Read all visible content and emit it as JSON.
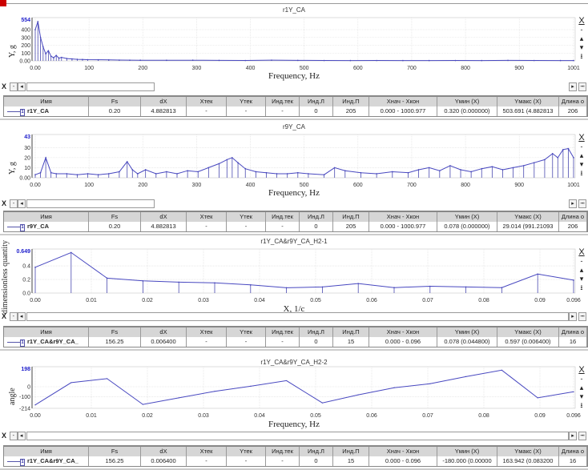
{
  "table_headers": [
    "Имя",
    "Fs",
    "dX",
    "Xтек",
    "Yтек",
    "Инд.тек",
    "Инд.Л",
    "Инд.П",
    "Xнач - Xкон",
    "Yмин (X)",
    "Yмакс (X)",
    "Длина о"
  ],
  "toolbar": {
    "close": "X",
    "zoom_out": "-",
    "pan_up": "▴",
    "pan_down": "▾",
    "fit": "⭳",
    "scroll_x": "X",
    "scroll_minus": "-",
    "left": "◂",
    "right": "▸",
    "end": "⭲"
  },
  "panels": [
    {
      "title": "r1Y_CA",
      "ylabel": "Y, g",
      "xlabel": "Frequency, Hz",
      "ymax_label": "554",
      "row": [
        "r1Y_CA",
        "0.20",
        "4.882813",
        "-",
        "-",
        "-",
        "0",
        "205",
        "0.000 - 1000.977",
        "0.320 (0.000000)",
        "503.691 (4.882813",
        "206"
      ]
    },
    {
      "title": "r9Y_CA",
      "ylabel": "Y, g",
      "xlabel": "Frequency, Hz",
      "ymax_label": "43",
      "row": [
        "r9Y_CA",
        "0.20",
        "4.882813",
        "-",
        "-",
        "-",
        "0",
        "205",
        "0.000 - 1000.977",
        "0.078 (0.000000)",
        "29.014 (991.21093",
        "206"
      ]
    },
    {
      "title": "r1Y_CA&r9Y_CA_H2-1",
      "ylabel": "dimensionless quantity",
      "xlabel": "X, 1/c",
      "ymax_label": "0.649",
      "row": [
        "r1Y_CA&r9Y_CA_",
        "156.25",
        "0.006400",
        "-",
        "-",
        "-",
        "0",
        "15",
        "0.000 - 0.096",
        "0.078 (0.044800)",
        "0.597 (0.006400)",
        "16"
      ]
    },
    {
      "title": "r1Y_CA&r9Y_CA_H2-2",
      "ylabel": "angle",
      "xlabel": "Frequency, Hz",
      "ymax_label": "198",
      "row": [
        "r1Y_CA&r9Y_CA_",
        "156.25",
        "0.006400",
        "-",
        "-",
        "-",
        "0",
        "15",
        "0.000 - 0.096",
        "-180.000 (0.00000",
        "163.942 (0.083200",
        "16"
      ]
    }
  ],
  "chart_data": [
    {
      "type": "line",
      "title": "r1Y_CA",
      "xlabel": "Frequency, Hz",
      "ylabel": "Y, g",
      "xlim": [
        0,
        1001
      ],
      "ylim": [
        0,
        554
      ],
      "xticks": [
        "0.00",
        "100",
        "200",
        "300",
        "400",
        "500",
        "600",
        "700",
        "800",
        "900",
        "1001"
      ],
      "xtick_values": [
        0,
        100,
        200,
        300,
        400,
        500,
        600,
        700,
        800,
        900,
        1001
      ],
      "yticks": [
        "0.00",
        "100",
        "200",
        "300",
        "400"
      ],
      "ytick_values": [
        0,
        100,
        200,
        300,
        400
      ],
      "x": [
        0,
        4.88,
        9.77,
        14.65,
        19.53,
        24.41,
        29.3,
        34.18,
        39.06,
        43.95,
        48.83,
        58.59,
        68.36,
        78.13,
        87.89,
        97.66,
        117.19,
        136.72,
        156.25,
        175.78,
        195.31,
        244.14,
        292.97,
        341.8,
        390.63,
        439.45,
        488.28,
        537.11,
        585.94,
        634.77,
        683.59,
        732.42,
        781.25,
        830.08,
        878.91,
        927.73,
        976.56,
        1000.98
      ],
      "values": [
        400,
        504,
        300,
        180,
        90,
        130,
        60,
        40,
        70,
        35,
        45,
        30,
        25,
        20,
        18,
        15,
        14,
        12,
        10,
        9,
        8,
        7,
        8,
        6,
        5,
        9,
        6,
        5,
        4,
        5,
        4,
        4,
        5,
        4,
        6,
        5,
        4,
        4
      ]
    },
    {
      "type": "line",
      "title": "r9Y_CA",
      "xlabel": "Frequency, Hz",
      "ylabel": "Y, g",
      "xlim": [
        0,
        1001
      ],
      "ylim": [
        0,
        43
      ],
      "xticks": [
        "0.00",
        "100",
        "200",
        "300",
        "400",
        "500",
        "600",
        "700",
        "800",
        "900",
        "1001"
      ],
      "xtick_values": [
        0,
        100,
        200,
        300,
        400,
        500,
        600,
        700,
        800,
        900,
        1001
      ],
      "yticks": [
        "0.00",
        "10",
        "20",
        "30"
      ],
      "ytick_values": [
        0,
        10,
        20,
        30
      ],
      "x": [
        0,
        9.77,
        19.53,
        29.3,
        39.06,
        58.59,
        78.13,
        97.66,
        117.19,
        136.72,
        156.25,
        170.9,
        180.66,
        190.43,
        205.08,
        224.61,
        244.14,
        263.67,
        283.2,
        302.73,
        322.27,
        341.8,
        356.45,
        366.21,
        376.95,
        390.63,
        410.16,
        429.69,
        449.22,
        468.75,
        488.28,
        507.81,
        537.11,
        556.64,
        576.17,
        605.47,
        634.77,
        664.06,
        693.36,
        712.89,
        732.42,
        751.95,
        771.48,
        791.02,
        810.55,
        830.08,
        849.61,
        869.14,
        888.67,
        908.2,
        927.73,
        947.27,
        961.91,
        971.68,
        981.45,
        991.21,
        1000.98
      ],
      "values": [
        3,
        5,
        20,
        5,
        4,
        4,
        3,
        4,
        3,
        4,
        6,
        16,
        8,
        4,
        8,
        4,
        6,
        4,
        7,
        6,
        10,
        14,
        18,
        20,
        15,
        9,
        6,
        5,
        4,
        4,
        5,
        4,
        3,
        10,
        7,
        5,
        4,
        6,
        5,
        8,
        10,
        7,
        12,
        8,
        6,
        9,
        11,
        8,
        10,
        12,
        15,
        18,
        24,
        20,
        28,
        29,
        20
      ]
    },
    {
      "type": "line",
      "title": "r1Y_CA&r9Y_CA_H2-1",
      "xlabel": "X, 1/c",
      "ylabel": "dimensionless quantity",
      "xlim": [
        0,
        0.096
      ],
      "ylim": [
        0,
        0.649
      ],
      "xticks": [
        "0.00",
        "0.01",
        "0.02",
        "0.03",
        "0.04",
        "0.05",
        "0.06",
        "0.07",
        "0.08",
        "0.09",
        "0.096"
      ],
      "xtick_values": [
        0,
        0.01,
        0.02,
        0.03,
        0.04,
        0.05,
        0.06,
        0.07,
        0.08,
        0.09,
        0.096
      ],
      "yticks": [
        "0.0",
        "0.2",
        "0.4"
      ],
      "ytick_values": [
        0,
        0.2,
        0.4
      ],
      "x": [
        0,
        0.0064,
        0.0128,
        0.0192,
        0.0256,
        0.032,
        0.0384,
        0.0448,
        0.0512,
        0.0576,
        0.064,
        0.0704,
        0.0768,
        0.0832,
        0.0896,
        0.096
      ],
      "values": [
        0.38,
        0.597,
        0.22,
        0.18,
        0.16,
        0.15,
        0.12,
        0.078,
        0.09,
        0.14,
        0.08,
        0.1,
        0.09,
        0.08,
        0.28,
        0.19
      ]
    },
    {
      "type": "line",
      "title": "r1Y_CA&r9Y_CA_H2-2",
      "xlabel": "Frequency, Hz",
      "ylabel": "angle",
      "xlim": [
        0,
        0.096
      ],
      "ylim": [
        -214,
        198
      ],
      "xticks": [
        "0.00",
        "0.01",
        "0.02",
        "0.03",
        "0.04",
        "0.05",
        "0.06",
        "0.07",
        "0.08",
        "0.09",
        "0.096"
      ],
      "xtick_values": [
        0,
        0.01,
        0.02,
        0.03,
        0.04,
        0.05,
        0.06,
        0.07,
        0.08,
        0.09,
        0.096
      ],
      "yticks": [
        "-214",
        "-100",
        "0"
      ],
      "ytick_values": [
        -214,
        -100,
        0
      ],
      "x": [
        0,
        0.0064,
        0.0128,
        0.0192,
        0.0256,
        0.032,
        0.0384,
        0.0448,
        0.0512,
        0.0576,
        0.064,
        0.0704,
        0.0768,
        0.0832,
        0.0896,
        0.096
      ],
      "values": [
        -180,
        40,
        80,
        -175,
        -110,
        -45,
        5,
        60,
        -160,
        -80,
        -10,
        30,
        100,
        164,
        -110,
        -50
      ]
    }
  ]
}
